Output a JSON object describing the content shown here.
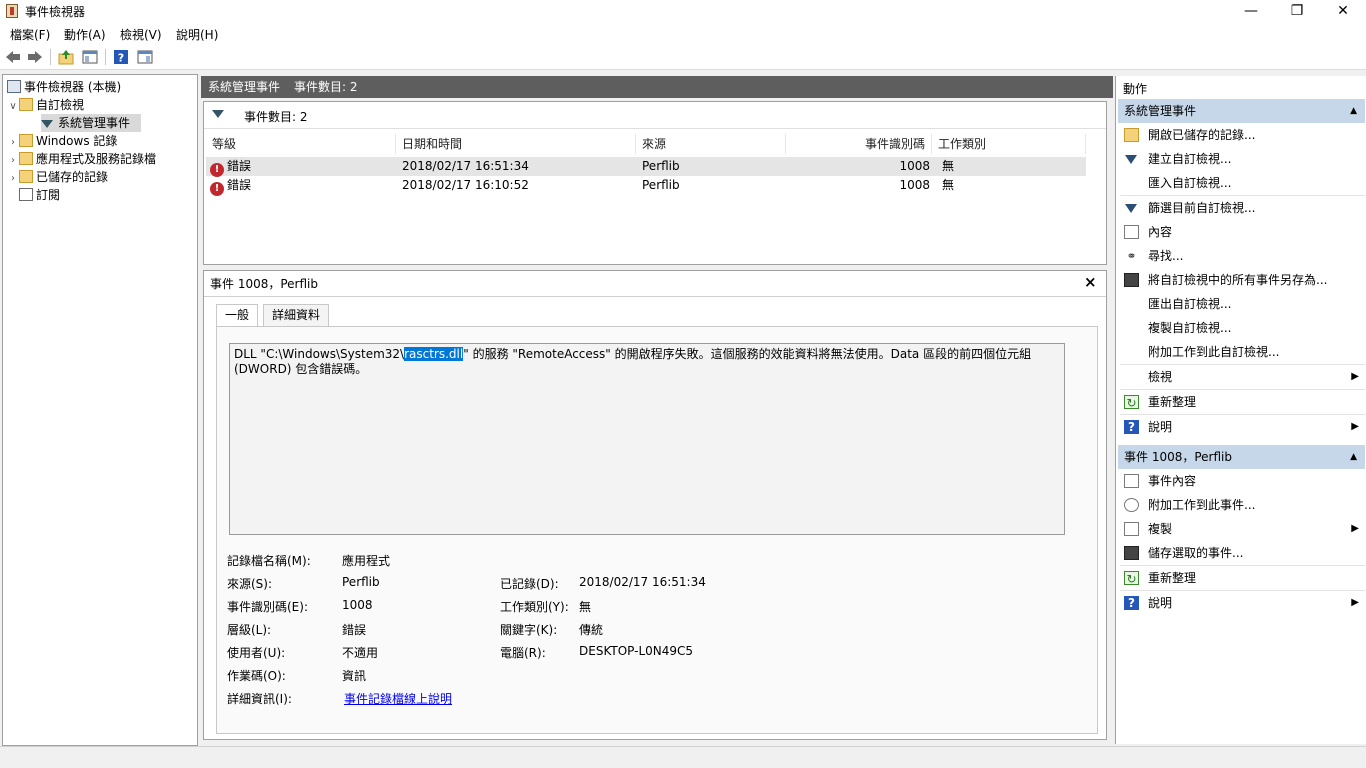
{
  "window": {
    "title": "事件檢視器",
    "minimize": "—",
    "restore": "❐",
    "close": "✕"
  },
  "menu": [
    "檔案(F)",
    "動作(A)",
    "檢視(V)",
    "說明(H)"
  ],
  "toolbar": {
    "icons": [
      "back-arrow-icon",
      "forward-arrow-icon",
      "up-folder-icon",
      "show-hide-console-tree-icon",
      "help-icon",
      "show-hide-action-pane-icon"
    ]
  },
  "tree": {
    "root": "事件檢視器 (本機)",
    "custom_views": "自訂檢視",
    "admin_events": "系統管理事件",
    "windows_logs": "Windows 記錄",
    "app_service_logs": "應用程式及服務記錄檔",
    "saved_logs": "已儲存的記錄",
    "subscriptions": "訂閱"
  },
  "middle": {
    "header_title": "系統管理事件",
    "header_count": "事件數目: 2",
    "list_count": "事件數目: 2",
    "columns": {
      "level": "等級",
      "datetime": "日期和時間",
      "source": "來源",
      "event_id": "事件識別碼",
      "task": "工作類別"
    },
    "rows": [
      {
        "level": "錯誤",
        "datetime": "2018/02/17 16:51:34",
        "source": "Perflib",
        "event_id": "1008",
        "task": "無"
      },
      {
        "level": "錯誤",
        "datetime": "2018/02/17 16:10:52",
        "source": "Perflib",
        "event_id": "1008",
        "task": "無"
      }
    ]
  },
  "detail": {
    "title": "事件 1008，Perflib",
    "close": "×",
    "tabs": {
      "general": "一般",
      "details": "詳細資料"
    },
    "description_pre": "DLL \"C:\\Windows\\System32\\",
    "description_hl": "rasctrs.dll",
    "description_post": "\" 的服務 \"RemoteAccess\" 的開啟程序失敗。這個服務的效能資料將無法使用。Data 區段的前四個位元組 (DWORD) 包含錯誤碼。",
    "labels": {
      "log_name": "記錄檔名稱(M):",
      "source": "來源(S):",
      "event_id": "事件識別碼(E):",
      "level": "層級(L):",
      "user": "使用者(U):",
      "opcode": "作業碼(O):",
      "more_info": "詳細資訊(I):",
      "logged": "已記錄(D):",
      "task": "工作類別(Y):",
      "keywords": "關鍵字(K):",
      "computer": "電腦(R):"
    },
    "values": {
      "log_name": "應用程式",
      "source": "Perflib",
      "event_id": "1008",
      "level": "錯誤",
      "user": "不適用",
      "opcode": "資訊",
      "more_info": "事件記錄檔線上說明",
      "logged": "2018/02/17 16:51:34",
      "task": "無",
      "keywords": "傳統",
      "computer": "DESKTOP-L0N49C5"
    }
  },
  "actions": {
    "title": "動作",
    "section1": "系統管理事件",
    "section1_items": [
      {
        "label": "開啟已儲存的記錄...",
        "icon": "open-folder-icon"
      },
      {
        "label": "建立自訂檢視...",
        "icon": "create-filter-icon"
      },
      {
        "label": "匯入自訂檢視...",
        "icon": ""
      },
      {
        "label": "篩選目前自訂檢視...",
        "icon": "filter-icon"
      },
      {
        "label": "內容",
        "icon": "properties-icon"
      },
      {
        "label": "尋找...",
        "icon": "binoculars-icon"
      },
      {
        "label": "將自訂檢視中的所有事件另存為...",
        "icon": "save-icon"
      },
      {
        "label": "匯出自訂檢視...",
        "icon": ""
      },
      {
        "label": "複製自訂檢視...",
        "icon": ""
      },
      {
        "label": "附加工作到此自訂檢視...",
        "icon": ""
      },
      {
        "label": "檢視",
        "icon": ""
      },
      {
        "label": "重新整理",
        "icon": "refresh-icon"
      },
      {
        "label": "說明",
        "icon": "help-icon"
      }
    ],
    "section2": "事件 1008，Perflib",
    "section2_items": [
      {
        "label": "事件內容",
        "icon": "event-properties-icon"
      },
      {
        "label": "附加工作到此事件...",
        "icon": "attach-task-icon"
      },
      {
        "label": "複製",
        "icon": "copy-icon"
      },
      {
        "label": "儲存選取的事件...",
        "icon": "save-icon"
      },
      {
        "label": "重新整理",
        "icon": "refresh-icon"
      },
      {
        "label": "說明",
        "icon": "help-icon"
      }
    ]
  },
  "colors": {
    "section_header": "#c5d7e9",
    "pane_header": "#5e5e5e",
    "selection": "#0078d7",
    "error": "#c0282d",
    "link": "#0000ee"
  }
}
